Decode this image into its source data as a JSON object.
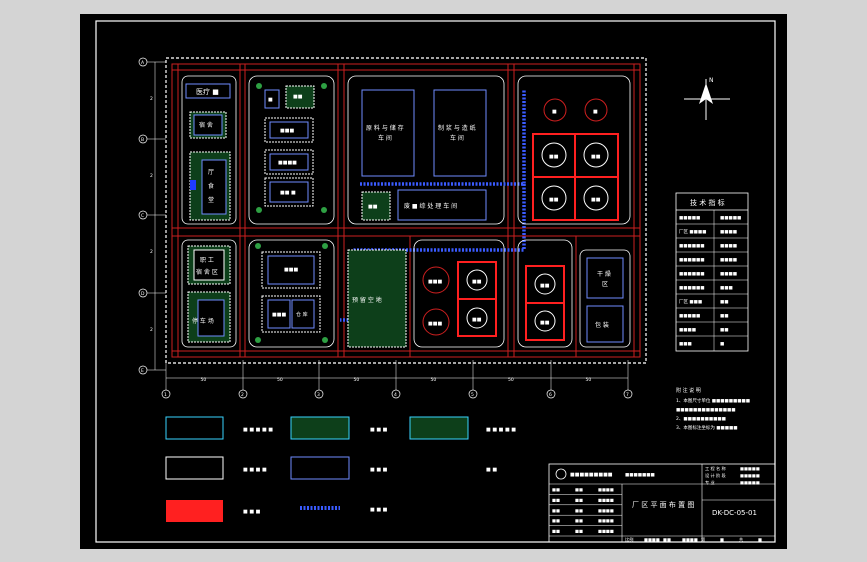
{
  "colors": {
    "app_bg": "#d4d4d4",
    "canvas": "#000000",
    "border": "#ffffff",
    "road": "#cc1f1f",
    "structure": "#6f8cff",
    "pipe": "#1f3bff",
    "green": "#1a8a2a",
    "text": "#ffffff"
  },
  "compass": {
    "label": "N"
  },
  "grid": {
    "rows": [
      {
        "id": "A",
        "gap": "2"
      },
      {
        "id": "B",
        "gap": "2"
      },
      {
        "id": "C",
        "gap": "2"
      },
      {
        "id": "D",
        "gap": "2"
      },
      {
        "id": "E",
        "gap": "2"
      },
      {
        "id": "F",
        "gap": ""
      }
    ],
    "cols": [
      {
        "id": "1",
        "gap": "50"
      },
      {
        "id": "2",
        "gap": "50"
      },
      {
        "id": "3",
        "gap": "50"
      },
      {
        "id": "4",
        "gap": "50"
      },
      {
        "id": "5",
        "gap": "50"
      },
      {
        "id": "6",
        "gap": "50"
      },
      {
        "id": "7",
        "gap": ""
      }
    ]
  },
  "buildings": {
    "office": "医疗 ■",
    "dorm": "宿 舍",
    "canteen": "厅",
    "canteen2": "食",
    "canteen3": "堂",
    "plant": "■",
    "w1": "■",
    "w2": "■■",
    "w3": "■■■",
    "w4": "■■■■",
    "w5": "■■ ■",
    "hall1": "原 料 与 储 存",
    "hall1b": "车 间",
    "hall2": "制 浆 与 造 纸",
    "hall2b": "车 间",
    "pool": "■■",
    "hall3": "废 ■ 综 处 理 车 间",
    "staff": "职 工",
    "staff2": "宿 舍 区",
    "parking": "停 车 场",
    "store1": "■■■",
    "store2": "■■■",
    "store3": "仓 库",
    "green_area": "预 留 空 地",
    "dry": "干 燥",
    "dry2": "区",
    "pack": "包 装"
  },
  "tanks": {
    "t_a": "■",
    "t_b": "■",
    "t_c": "■■",
    "t_d": "■■",
    "t_e": "■■",
    "t_f": "■■",
    "t_g": "■■■",
    "t_h": "■■",
    "t_i": "■■■",
    "t_j": "■■",
    "t_k": "■■",
    "t_l": "■■"
  },
  "tech_table": {
    "title": "技 术 指 标",
    "rows": [
      {
        "label": "■■■■■",
        "value": "■■■■■"
      },
      {
        "label": "厂区 ■■■■",
        "value": "■■■■"
      },
      {
        "label": "■■■■■■",
        "value": "■■■■"
      },
      {
        "label": "■■■■■■",
        "value": "■■■■"
      },
      {
        "label": "■■■■■■",
        "value": "■■■■"
      },
      {
        "label": "■■■■■■",
        "value": "■■■"
      },
      {
        "label": "厂区 ■■■",
        "value": "■■"
      },
      {
        "label": "■■■■■",
        "value": "■■"
      },
      {
        "label": "■■■■",
        "value": "■■"
      },
      {
        "label": "■■■",
        "value": "■"
      }
    ]
  },
  "notes": {
    "title": "附 注 说 明",
    "lines": [
      "1、本图尺寸单位 ■■■■■■■■■",
      "■■■■■■■■■■■■■■",
      "2、■■■■■■■■■■",
      "3、本图标注坐标为 ■■■■■"
    ]
  },
  "legend": [
    {
      "label": "■ ■ ■ ■ ■"
    },
    {
      "label": "■ ■ ■"
    },
    {
      "label": "■ ■ ■ ■ ■"
    },
    {
      "label": "■ ■ ■ ■"
    },
    {
      "label": "■ ■ ■"
    },
    {
      "label": "■ ■ ■"
    },
    {
      "label": "■ ■ ■"
    },
    {
      "label": "■ ■"
    }
  ],
  "title_block": {
    "org": "■■■■■■■■■",
    "design_label": "■■■■■■■",
    "drawing_title": "厂 区 平 面 布 置 图",
    "drawing_no": "DK-DC-05-01",
    "right_rows": [
      {
        "label": "工 程 名 称",
        "value": "■■■■■"
      },
      {
        "label": "设 计 阶 段",
        "value": "■■■■■"
      },
      {
        "label": "专 业",
        "value": "■■■■■"
      }
    ],
    "left_rows": [
      {
        "role": "■■",
        "name": "■■",
        "date": "■■■■"
      },
      {
        "role": "■■",
        "name": "■■",
        "date": "■■■■"
      },
      {
        "role": "■■",
        "name": "■■",
        "date": "■■■■"
      },
      {
        "role": "■■",
        "name": "■■",
        "date": "■■■■"
      },
      {
        "role": "■■",
        "name": "■■",
        "date": "■■■■"
      }
    ],
    "bottom": [
      "比例",
      "■■■■",
      "■■",
      "■■■■",
      "第",
      "■",
      "共",
      "■"
    ]
  }
}
